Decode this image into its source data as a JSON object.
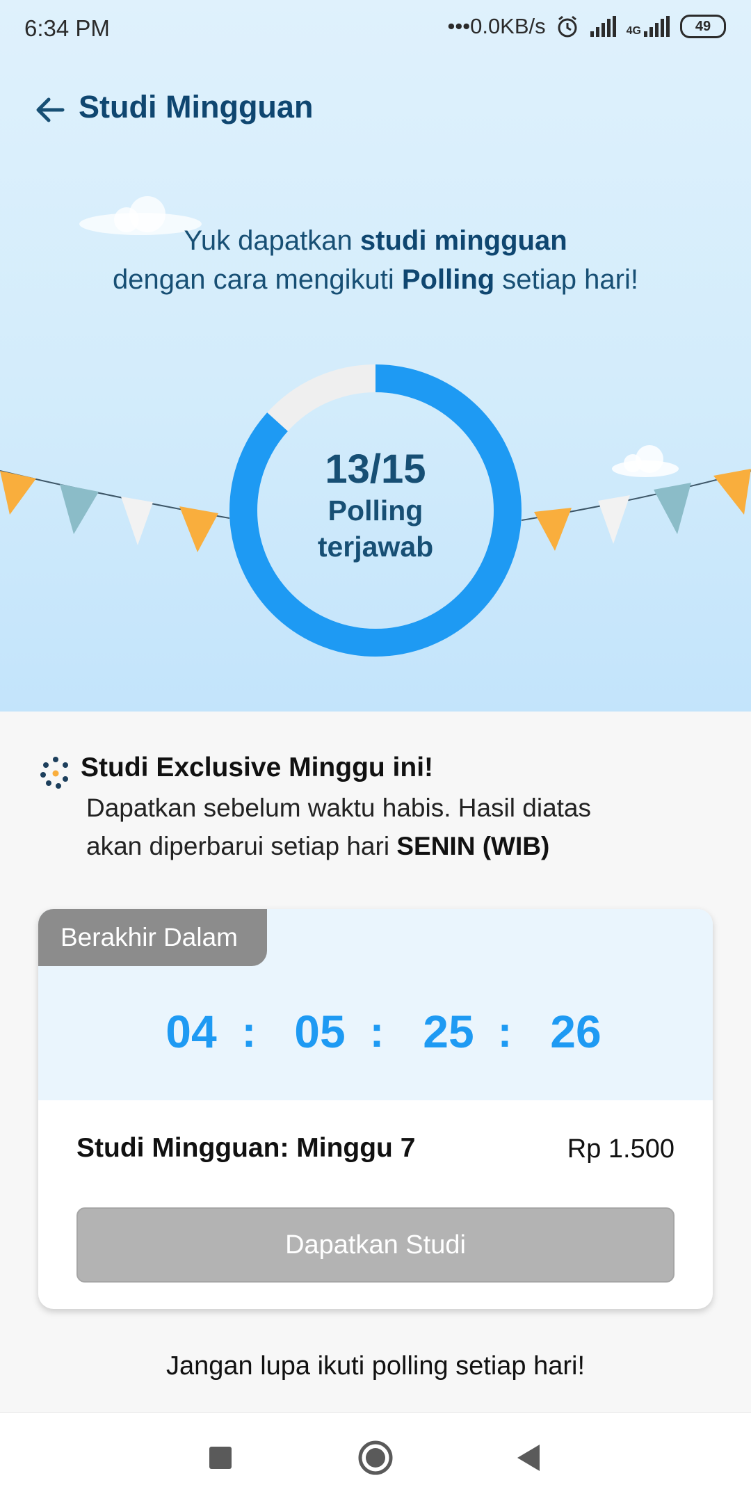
{
  "status_bar": {
    "time": "6:34 PM",
    "net_speed": "•••0.0KB/s",
    "network": "4G",
    "battery": "49",
    "icons": [
      "alarm-icon",
      "signal-icon",
      "signal-4g-icon",
      "battery-icon"
    ]
  },
  "header": {
    "title": "Studi Mingguan",
    "back_icon": "arrow-left-icon"
  },
  "intro": {
    "line1_pre": "Yuk dapatkan ",
    "line1_bold": "studi mingguan",
    "line2_pre": "dengan cara mengikuti ",
    "line2_bold": "Polling",
    "line2_post": " setiap hari!"
  },
  "progress": {
    "count_text": "13/15",
    "answered": 13,
    "total": 15,
    "label_line1": "Polling",
    "label_line2": "terjawab"
  },
  "study_section": {
    "title": "Studi Exclusive Minggu ini!",
    "desc_line1": "Dapatkan sebelum waktu habis. Hasil diatas",
    "desc_line2_pre": "akan diperbarui setiap hari ",
    "desc_line2_bold": "SENIN (WIB)"
  },
  "card": {
    "badge": "Berakhir Dalam",
    "timer": {
      "d": "04",
      "h": "05",
      "m": "25",
      "s": "26",
      "sep": ":"
    },
    "product_name": "Studi Mingguan: Minggu 7",
    "price": "Rp 1.500",
    "cta_label": "Dapatkan Studi"
  },
  "footer_note": "Jangan lupa ikuti polling setiap hari!",
  "nav": {
    "icons": [
      "recent-apps-icon",
      "home-icon",
      "back-triangle-icon"
    ]
  },
  "colors": {
    "primary": "#1e9af3",
    "track": "#efefef",
    "title": "#0f4670",
    "disabled": "#b3b3b3",
    "flag_orange": "#f9ae3d",
    "flag_teal": "#8bbcc8",
    "flag_white": "#f2f2f2"
  }
}
